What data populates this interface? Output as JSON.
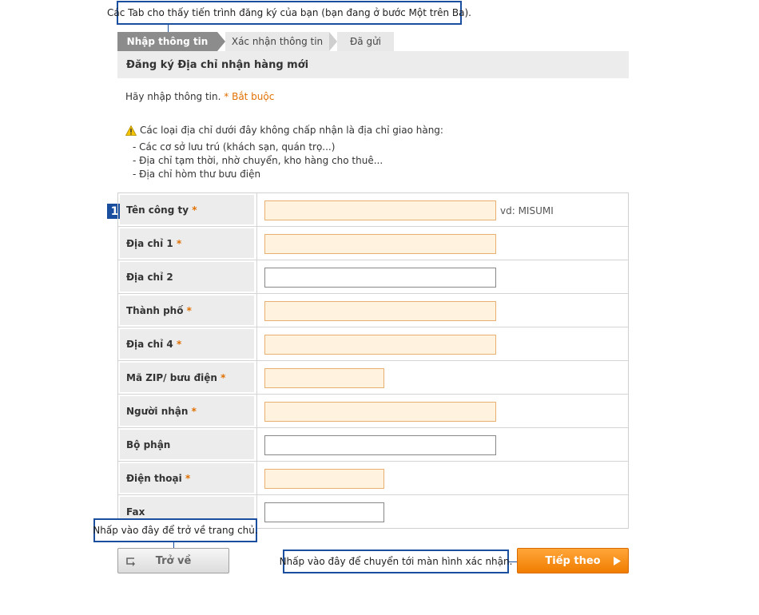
{
  "callouts": {
    "tabs_hint": "Các Tab cho thấy tiến trình đăng ký của bạn (bạn đang ở bước Một trên Ba).",
    "back_hint": "Nhấp vào đây để trở về trang chủ.",
    "next_hint": "Nhấp vào đây để chuyển tới màn hình xác nhận."
  },
  "steps": [
    {
      "label": "Nhập thông tin",
      "state": "active"
    },
    {
      "label": "Xác nhận thông tin",
      "state": "inactive"
    },
    {
      "label": "Đã gửi",
      "state": "inactive"
    }
  ],
  "section_title": "Đăng ký Địa chỉ nhận hàng mới",
  "intro": {
    "text": "Hãy nhập thông tin.",
    "required_note": "* Bắt buộc"
  },
  "notice": {
    "icon": "warning-icon",
    "heading": "Các loại địa chỉ dưới đây không chấp nhận là địa chỉ giao hàng:",
    "items": [
      "- Các cơ sở lưu trú (khách sạn, quán trọ...)",
      "- Địa chỉ tạm thời, nhờ chuyển, kho hàng cho thuê...",
      "- Địa chỉ hòm thư bưu điện"
    ]
  },
  "marker": "1",
  "fields": [
    {
      "label": "Tên công ty",
      "required": "*",
      "value": "",
      "hint": "vd: MISUMI"
    },
    {
      "label": "Địa chỉ 1",
      "required": "*",
      "value": ""
    },
    {
      "label": "Địa chỉ 2",
      "required": "",
      "value": ""
    },
    {
      "label": "Thành phố",
      "required": "*",
      "value": ""
    },
    {
      "label": "Địa chỉ 4",
      "required": "*",
      "value": ""
    },
    {
      "label": "Mã ZIP/ bưu điện",
      "required": "*",
      "value": ""
    },
    {
      "label": "Người nhận",
      "required": "*",
      "value": ""
    },
    {
      "label": "Bộ phận",
      "required": "",
      "value": ""
    },
    {
      "label": "Điện thoại",
      "required": "*",
      "value": ""
    },
    {
      "label": "Fax",
      "required": "",
      "value": ""
    }
  ],
  "buttons": {
    "back": "Trở về",
    "next": "Tiếp theo"
  },
  "colors": {
    "accent": "#f07d00",
    "callout_border": "#1a4fa0",
    "required": "#e07000",
    "input_required_bg": "#fff3e0"
  }
}
